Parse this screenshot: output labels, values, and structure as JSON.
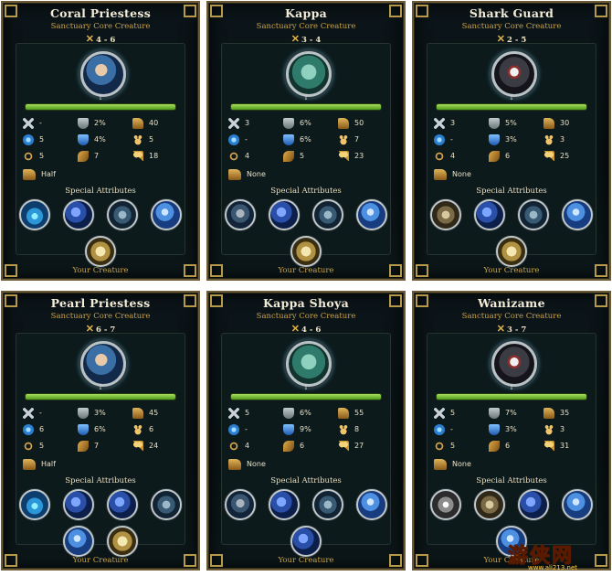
{
  "panels": [
    {
      "name": "Coral Priestess",
      "subtitle": "Sanctuary Core Creature",
      "range": "4 - 6",
      "level": "1",
      "portrait": "blue",
      "stats": [
        [
          "-",
          "2%",
          "40"
        ],
        [
          "5",
          "4%",
          "5"
        ],
        [
          "5",
          "7",
          "18"
        ]
      ],
      "movement": "Half",
      "special_label": "Special Attributes",
      "orbs": [
        [
          "water",
          "water-orb-icon"
        ],
        [
          "serpent",
          "serpent-orb-icon"
        ],
        [
          "beast",
          "beast-orb-icon"
        ],
        [
          "blue",
          "blue-orb-icon"
        ],
        [
          "man",
          "vitruvian-orb-icon"
        ]
      ],
      "footer": "Your Creature"
    },
    {
      "name": "Kappa",
      "subtitle": "Sanctuary Core Creature",
      "range": "3 - 4",
      "level": "1",
      "portrait": "green",
      "stats": [
        [
          "3",
          "6%",
          "50"
        ],
        [
          "-",
          "6%",
          "7"
        ],
        [
          "4",
          "5",
          "23"
        ]
      ],
      "movement": "None",
      "special_label": "Special Attributes",
      "orbs": [
        [
          "bird",
          "bird-orb-icon"
        ],
        [
          "serpent",
          "serpent-orb-icon"
        ],
        [
          "beast",
          "beast-orb-icon"
        ],
        [
          "blue",
          "blue-orb-icon"
        ],
        [
          "man",
          "vitruvian-orb-icon"
        ]
      ],
      "footer": "Your Creature"
    },
    {
      "name": "Shark Guard",
      "subtitle": "Sanctuary Core Creature",
      "range": "2 - 5",
      "level": "1",
      "portrait": "dark",
      "stats": [
        [
          "3",
          "5%",
          "30"
        ],
        [
          "-",
          "3%",
          "3"
        ],
        [
          "4",
          "6",
          "25"
        ]
      ],
      "movement": "None",
      "special_label": "Special Attributes",
      "orbs": [
        [
          "stone",
          "stone-orb-icon"
        ],
        [
          "serpent",
          "serpent-orb-icon"
        ],
        [
          "beast",
          "beast-orb-icon"
        ],
        [
          "blue",
          "blue-orb-icon"
        ],
        [
          "man",
          "vitruvian-orb-icon"
        ]
      ],
      "footer": "Your Creature"
    },
    {
      "name": "Pearl Priestess",
      "subtitle": "Sanctuary Core Creature",
      "range": "6 - 7",
      "level": "1",
      "portrait": "blue",
      "stats": [
        [
          "-",
          "3%",
          "45"
        ],
        [
          "6",
          "6%",
          "6"
        ],
        [
          "5",
          "7",
          "24"
        ]
      ],
      "movement": "Half",
      "special_label": "Special Attributes",
      "orbs": [
        [
          "water",
          "water-orb-icon"
        ],
        [
          "serpent",
          "serpent-orb-icon"
        ],
        [
          "serpent",
          "serpent-orb-icon"
        ],
        [
          "beast",
          "beast-orb-icon"
        ],
        [
          "blue",
          "blue-orb-icon"
        ],
        [
          "man",
          "vitruvian-orb-icon"
        ]
      ],
      "footer": "Your Creature"
    },
    {
      "name": "Kappa Shoya",
      "subtitle": "Sanctuary Core Creature",
      "range": "4 - 6",
      "level": "1",
      "portrait": "green",
      "stats": [
        [
          "5",
          "6%",
          "55"
        ],
        [
          "-",
          "9%",
          "8"
        ],
        [
          "4",
          "6",
          "27"
        ]
      ],
      "movement": "None",
      "special_label": "Special Attributes",
      "orbs": [
        [
          "bird",
          "bird-orb-icon"
        ],
        [
          "serpent",
          "serpent-orb-icon"
        ],
        [
          "beast",
          "beast-orb-icon"
        ],
        [
          "blue",
          "blue-orb-icon"
        ],
        [
          "serpent",
          "serpent-orb-icon"
        ]
      ],
      "footer": "Your Creature"
    },
    {
      "name": "Wanizame",
      "subtitle": "Sanctuary Core Creature",
      "range": "3 - 7",
      "level": "1",
      "portrait": "dark",
      "stats": [
        [
          "5",
          "7%",
          "35"
        ],
        [
          "-",
          "3%",
          "3"
        ],
        [
          "5",
          "6",
          "31"
        ]
      ],
      "movement": "None",
      "special_label": "Special Attributes",
      "orbs": [
        [
          "shark",
          "shark-orb-icon"
        ],
        [
          "stone",
          "stone-orb-icon"
        ],
        [
          "serpent",
          "serpent-orb-icon"
        ],
        [
          "blue",
          "blue-orb-icon"
        ],
        [
          "blue",
          "blue-orb-icon"
        ]
      ],
      "footer": "Your Creature"
    }
  ],
  "stat_icons": [
    [
      "sword-icon",
      "shield-icon",
      "boot-icon"
    ],
    [
      "magic-icon",
      "magic-shield-icon",
      "paw-icon"
    ],
    [
      "lasso-icon",
      "wing-icon",
      "heart-icon"
    ]
  ],
  "watermark": {
    "text": "游侠网",
    "url": "www.ali213.net"
  }
}
